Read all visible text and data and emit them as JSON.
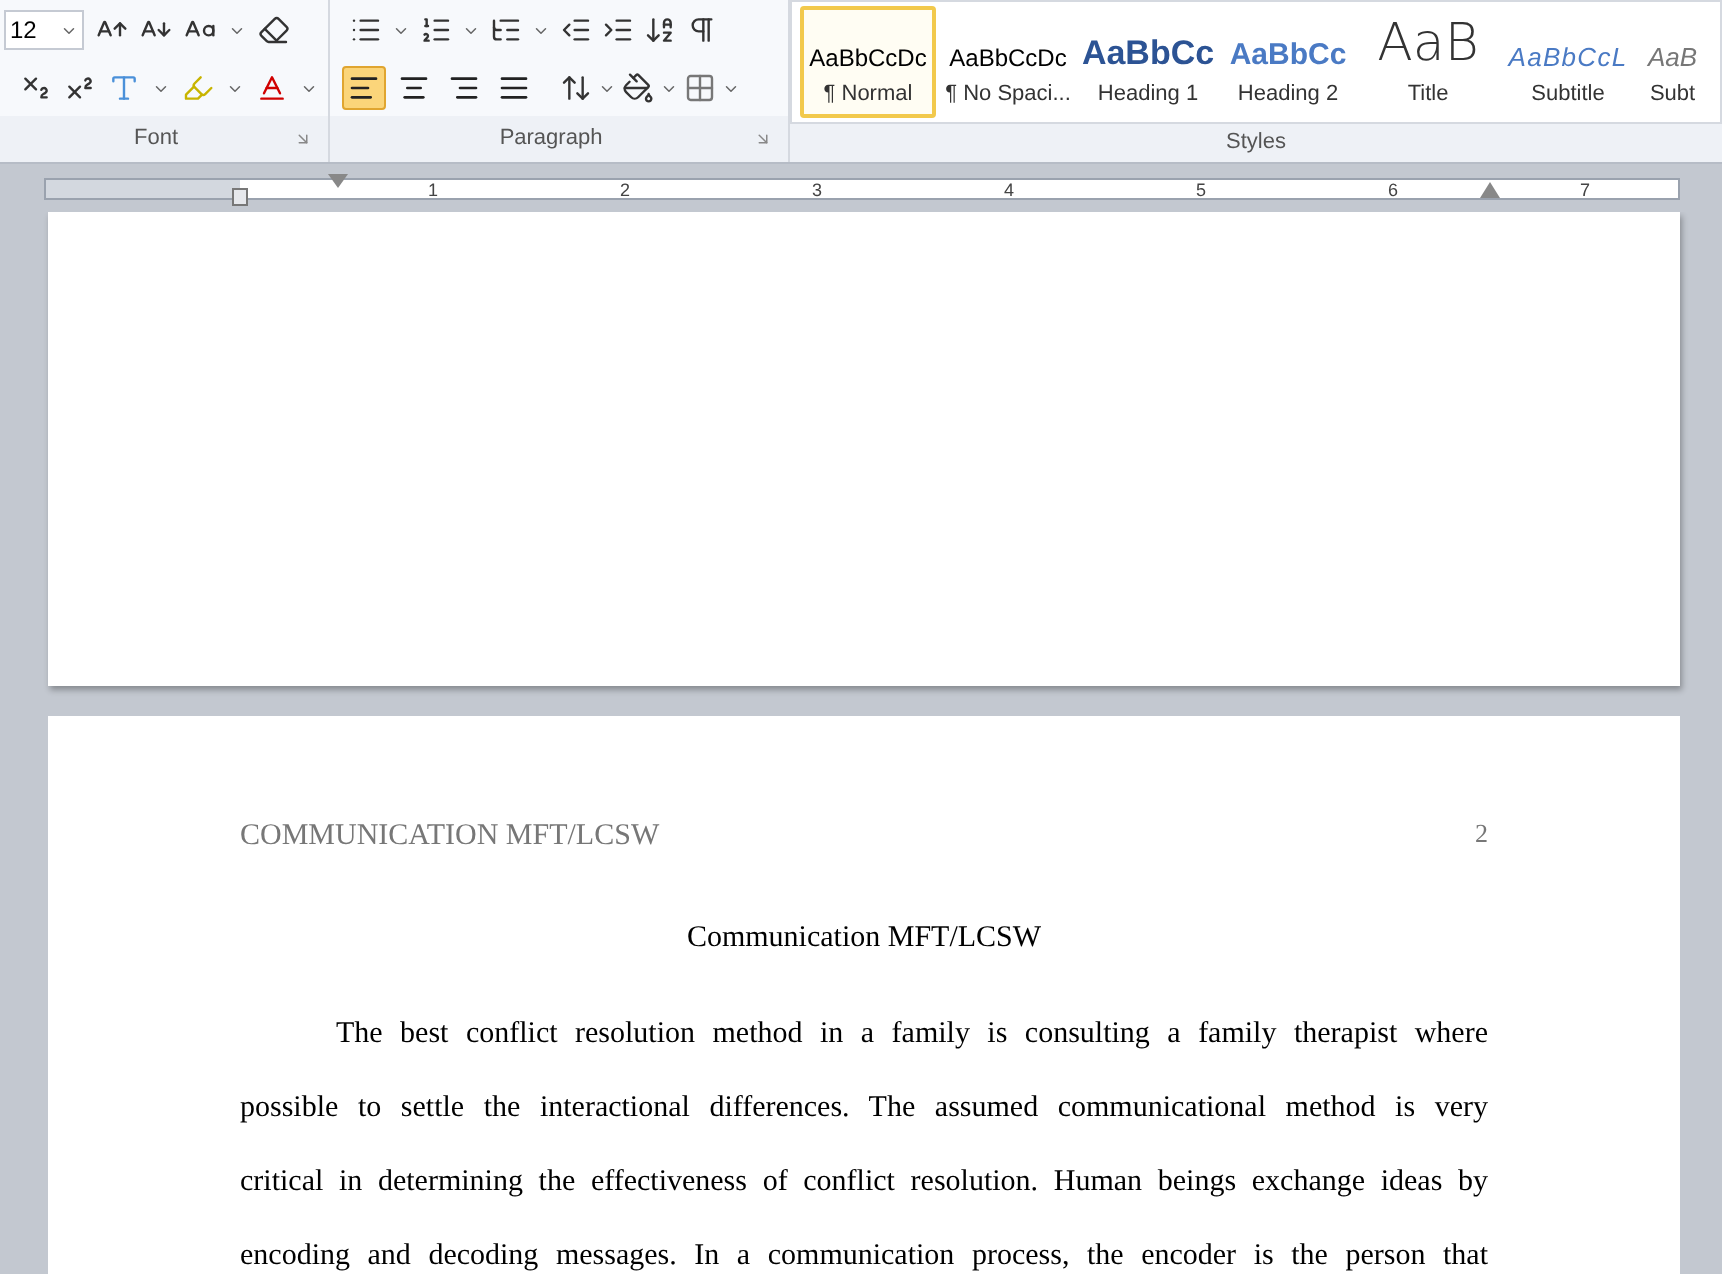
{
  "ribbon": {
    "font": {
      "label": "Font",
      "size": "12"
    },
    "paragraph": {
      "label": "Paragraph",
      "alignments": [
        {
          "kind": "left",
          "selected": true
        },
        {
          "kind": "center",
          "selected": false
        },
        {
          "kind": "right",
          "selected": false
        },
        {
          "kind": "justify",
          "selected": false
        }
      ]
    },
    "styles": {
      "label": "Styles",
      "items": [
        {
          "preview": "AaBbCcDc",
          "name": "¶ Normal",
          "kind": "normal",
          "selected": true
        },
        {
          "preview": "AaBbCcDc",
          "name": "¶ No Spaci...",
          "kind": "normal",
          "selected": false
        },
        {
          "preview": "AaBbCc",
          "name": "Heading 1",
          "kind": "heading1",
          "selected": false
        },
        {
          "preview": "AaBbCc",
          "name": "Heading 2",
          "kind": "heading2",
          "selected": false
        },
        {
          "preview": "AaB",
          "name": "Title",
          "kind": "title",
          "selected": false
        },
        {
          "preview": "AaBbCcL",
          "name": "Subtitle",
          "kind": "subtitle",
          "selected": false
        },
        {
          "preview": "AaB",
          "name": "Subt",
          "kind": "subtle",
          "selected": false
        }
      ]
    }
  },
  "ruler": {
    "numbers": [
      "1",
      "2",
      "3",
      "4",
      "5",
      "6",
      "7"
    ]
  },
  "page": {
    "header": "COMMUNICATION MFT/LCSW",
    "page_number": "2",
    "title": "Communication MFT/LCSW",
    "lines": [
      "The best conflict resolution method in a family is consulting a family therapist where",
      "possible to settle the interactional differences. The assumed communicational  method is very",
      "critical in determining the effectiveness of conflict resolution. Human beings exchange ideas by",
      "encoding and decoding messages. In a communication process, the encoder is the person that"
    ]
  }
}
